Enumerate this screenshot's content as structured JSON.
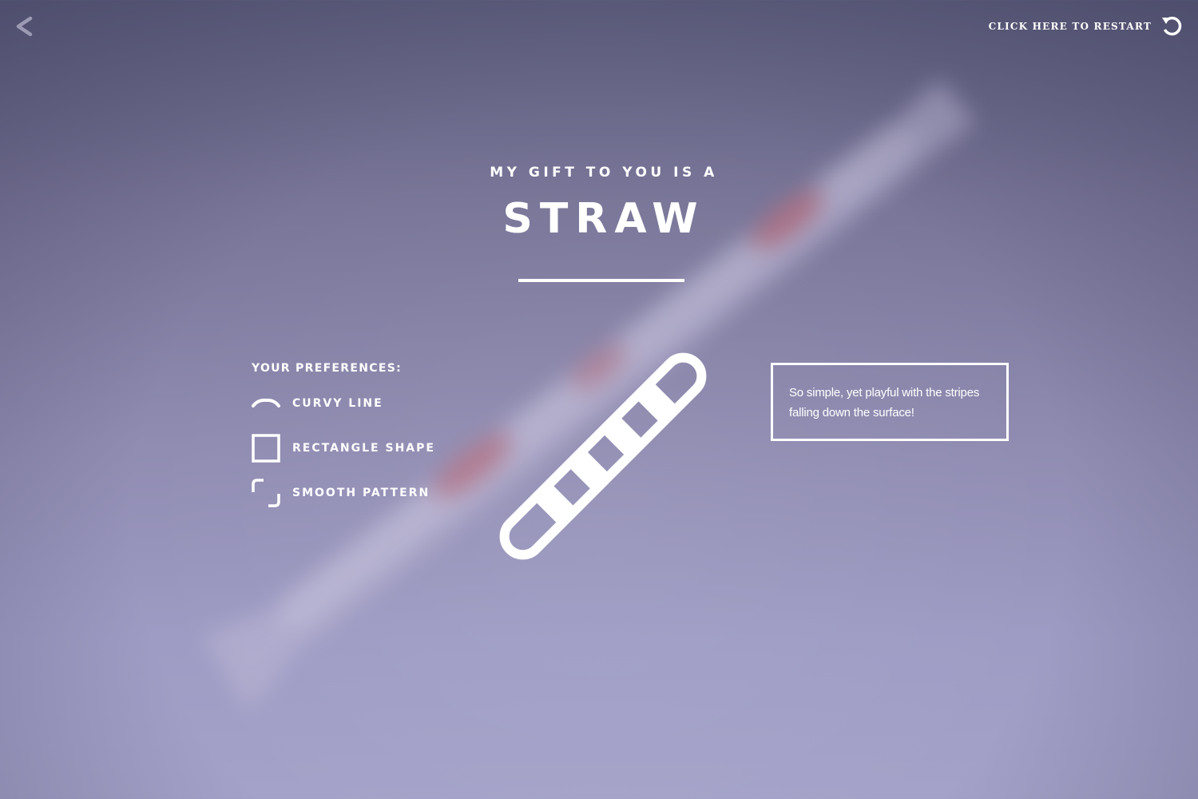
{
  "nav": {
    "back_icon": "chevron-left-icon",
    "restart_label": "CLICK HERE TO RESTART",
    "restart_icon": "restart-icon"
  },
  "hero": {
    "subtitle": "MY GIFT TO YOU IS A",
    "title": "STRAW"
  },
  "preferences": {
    "heading": "YOUR PREFERENCES:",
    "items": [
      {
        "label": "CURVY LINE",
        "icon": "curvy-line-icon"
      },
      {
        "label": "RECTANGLE SHAPE",
        "icon": "rectangle-shape-icon"
      },
      {
        "label": "SMOOTH PATTERN",
        "icon": "smooth-pattern-icon"
      }
    ]
  },
  "gift": {
    "icon": "straw-icon",
    "description": "So simple, yet playful with the stripes falling down the surface!"
  },
  "colors": {
    "foreground": "#ffffff",
    "background_top": "#5d5d7c",
    "background_bottom": "#a4a2c8",
    "straw_accent": "#c45a6a"
  }
}
